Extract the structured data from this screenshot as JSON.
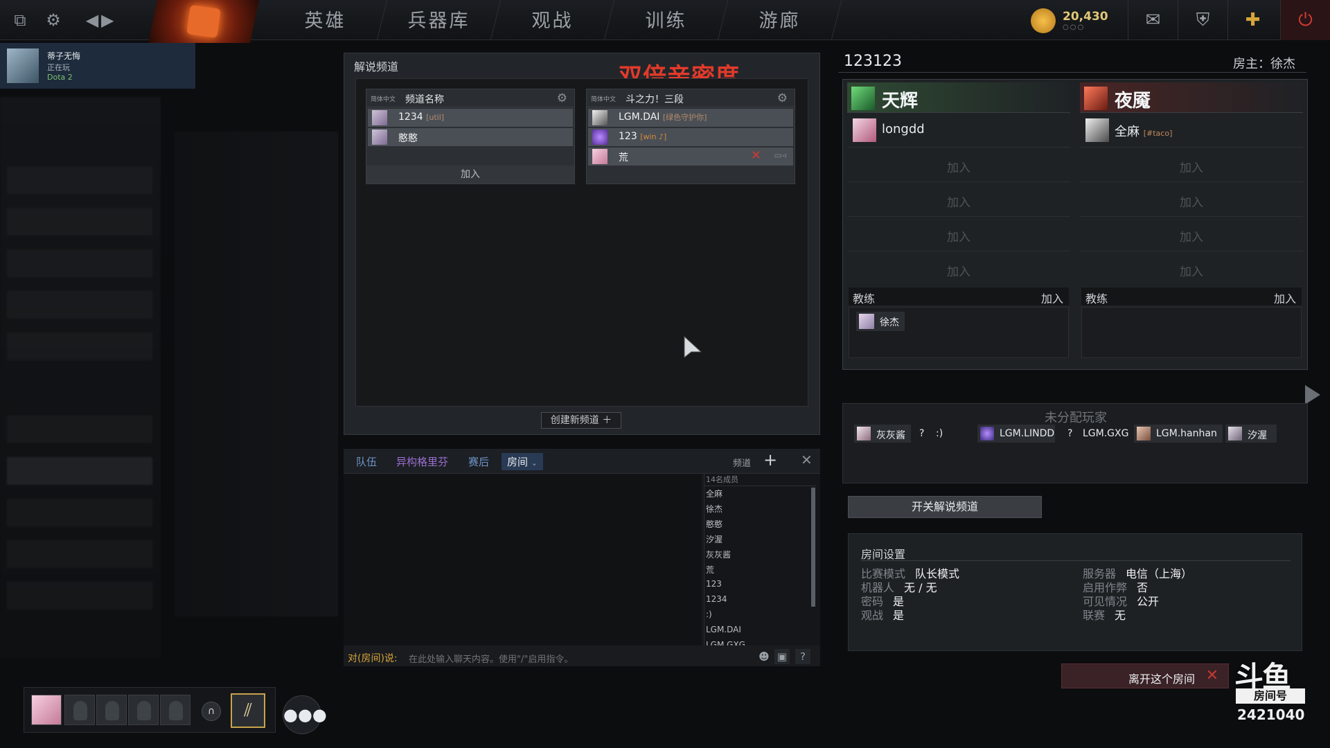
{
  "nav": {
    "tabs": [
      "英雄",
      "兵器库",
      "观战",
      "训练",
      "游廊"
    ],
    "currency": "20,430",
    "currency_sub": "○○○"
  },
  "user": {
    "name": "蒂子无悔",
    "status": "正在玩",
    "game": "Dota 2"
  },
  "broadcast": {
    "title": "解说频道",
    "promo": "双倍亲密度",
    "create_label": "创建新频道 ＋",
    "channels": [
      {
        "lang": "简体中文",
        "name": "频道名称",
        "members": [
          {
            "name": "1234",
            "tag": "[util]"
          },
          {
            "name": "憨憨",
            "tag": ""
          }
        ],
        "join_label": "加入"
      },
      {
        "lang": "简体中文",
        "name": "斗之力！三段",
        "members": [
          {
            "name": "LGM.DAI",
            "tag": "[绿色守护你]"
          },
          {
            "name": "123",
            "tag": "[win ♪]"
          },
          {
            "name": "荒",
            "tag": ""
          }
        ]
      }
    ]
  },
  "chat": {
    "tabs": [
      "队伍",
      "异构格里芬",
      "赛后",
      "房间"
    ],
    "channel_label": "频道",
    "members_count": "14名成员",
    "members": [
      "全麻",
      "徐杰",
      "憨憨",
      "汐渥",
      "灰灰酱",
      "荒",
      "123",
      "1234",
      ":)",
      "LGM.DAI",
      "LGM.GXG"
    ],
    "input_label": "对(房间)说:",
    "input_placeholder": "在此处输入聊天内容。使用\"/\"启用指令。"
  },
  "lobby": {
    "id": "123123",
    "host": "房主：徐杰",
    "radiant": {
      "name": "天辉",
      "player": {
        "name": "longdd",
        "tag": ""
      },
      "join_label": "加入",
      "coach_label": "教练",
      "coach_join": "加入",
      "coach": "徐杰"
    },
    "dire": {
      "name": "夜魇",
      "player": {
        "name": "全麻",
        "tag": "[#taco]"
      },
      "join_label": "加入",
      "coach_label": "教练",
      "coach_join": "加入"
    },
    "unassigned_title": "未分配玩家",
    "unassigned": [
      "灰灰酱",
      "?",
      ":)",
      "LGM.LINDD",
      "?",
      "LGM.GXG",
      "LGM.hanhan",
      "汐渥"
    ],
    "toggle_broadcast": "开关解说频道",
    "settings": {
      "title": "房间设置",
      "left": [
        {
          "k": "比赛模式",
          "v": "队长模式"
        },
        {
          "k": "机器人",
          "v": "无 / 无"
        },
        {
          "k": "密码",
          "v": "是"
        },
        {
          "k": "观战",
          "v": "是"
        }
      ],
      "right": [
        {
          "k": "服务器",
          "v": "电信（上海）"
        },
        {
          "k": "启用作弊",
          "v": "否"
        },
        {
          "k": "可见情况",
          "v": "公开"
        },
        {
          "k": "联赛",
          "v": "无"
        }
      ]
    },
    "leave_label": "离开这个房间"
  },
  "watermark": {
    "logo": "斗鱼",
    "label": "房间号",
    "number": "2421040"
  },
  "colors": {
    "accent_gold": "#d6a53a",
    "promo_red": "#e23a2a",
    "radiant_green": "#3aa35a",
    "dire_red": "#b33a2a"
  }
}
